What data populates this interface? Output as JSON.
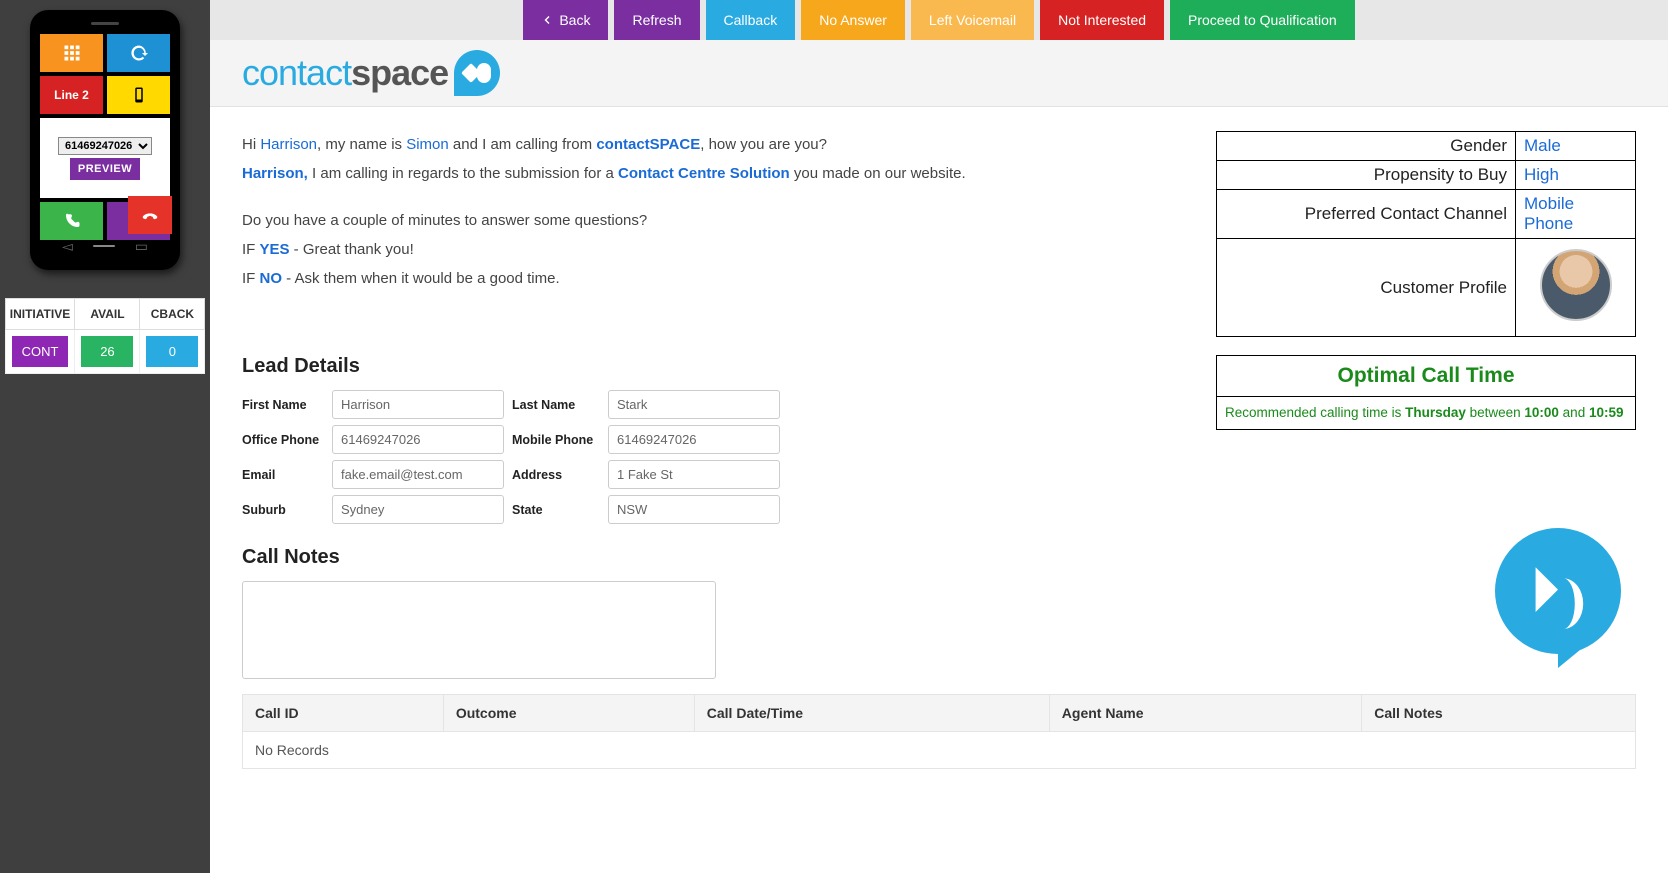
{
  "phone": {
    "line_label": "Line 2",
    "number": "61469247026",
    "preview_label": "PREVIEW"
  },
  "status": {
    "headers": [
      "INITIATIVE",
      "AVAIL",
      "CBACK"
    ],
    "initiative": "CONT",
    "avail": "26",
    "cback": "0"
  },
  "topbar": {
    "back": "Back",
    "refresh": "Refresh",
    "callback": "Callback",
    "no_answer": "No Answer",
    "left_vm": "Left Voicemail",
    "not_interested": "Not Interested",
    "proceed": "Proceed to Qualification"
  },
  "logo": {
    "part1": "contact",
    "part2": "space"
  },
  "script": {
    "l1a": "Hi ",
    "l1_name": "Harrison",
    "l1b": ", my name is ",
    "l1_agent": "Simon",
    "l1c": " and I am calling from ",
    "l1_brand": "contactSPACE",
    "l1d": ", how you are you?",
    "l2_name": "Harrison,",
    "l2a": " I am calling in regards to the submission for a ",
    "l2_prod": "Contact Centre Solution",
    "l2b": " you made on our website.",
    "l3": "Do you have a couple of minutes to answer some questions?",
    "l4a": "IF ",
    "l4_yes": "YES",
    "l4b": " - Great thank you!",
    "l5a": "IF ",
    "l5_no": "NO",
    "l5b": " - Ask them when it would be a good time."
  },
  "profile": {
    "rows": [
      {
        "label": "Gender",
        "value": "Male"
      },
      {
        "label": "Propensity to Buy",
        "value": "High"
      },
      {
        "label": "Preferred Contact Channel",
        "value": "Mobile Phone"
      }
    ],
    "customer_profile_label": "Customer Profile"
  },
  "lead": {
    "heading": "Lead Details",
    "fields": {
      "first_name": {
        "label": "First Name",
        "value": "Harrison"
      },
      "last_name": {
        "label": "Last Name",
        "value": "Stark"
      },
      "office_phone": {
        "label": "Office Phone",
        "value": "61469247026"
      },
      "mobile_phone": {
        "label": "Mobile Phone",
        "value": "61469247026"
      },
      "email": {
        "label": "Email",
        "value": "fake.email@test.com"
      },
      "address": {
        "label": "Address",
        "value": "1 Fake St"
      },
      "suburb": {
        "label": "Suburb",
        "value": "Sydney"
      },
      "state": {
        "label": "State",
        "value": "NSW"
      }
    }
  },
  "optimal": {
    "title": "Optimal Call Time",
    "text_a": "Recommended calling time is ",
    "day": "Thursday",
    "text_b": " between ",
    "t1": "10:00",
    "and": " and ",
    "t2": "10:59"
  },
  "notes": {
    "heading": "Call Notes"
  },
  "history": {
    "headers": [
      "Call ID",
      "Outcome",
      "Call Date/Time",
      "Agent Name",
      "Call Notes"
    ],
    "empty": "No Records"
  }
}
